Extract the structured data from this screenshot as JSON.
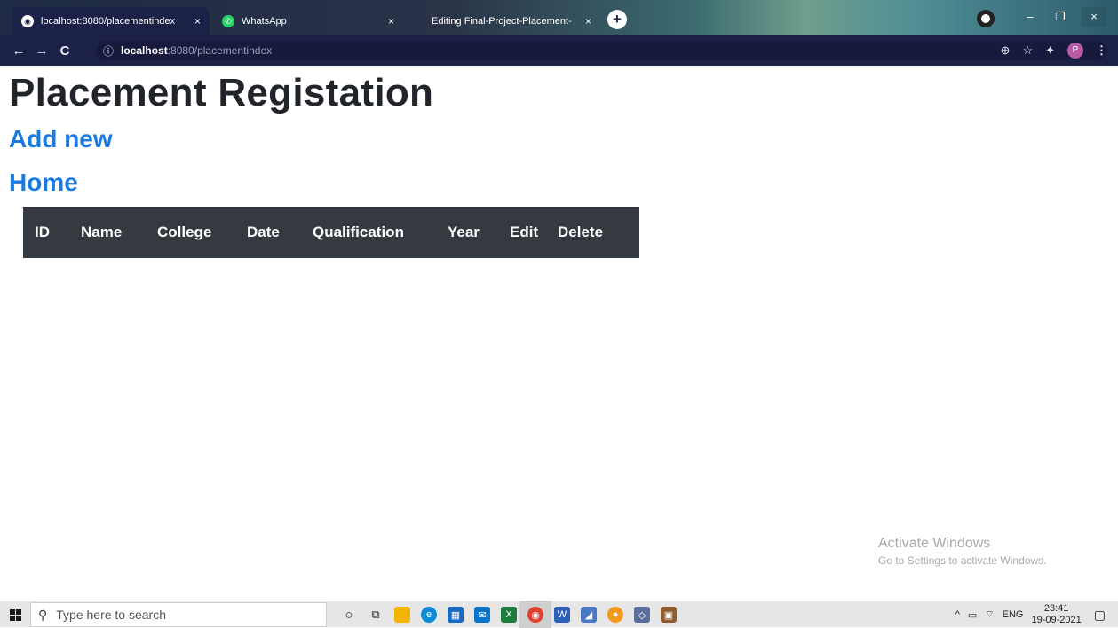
{
  "browser": {
    "tabs": [
      {
        "title": "localhost:8080/placementindex",
        "close": "×",
        "icon": "globe-icon",
        "active": true
      },
      {
        "title": "WhatsApp",
        "close": "×",
        "icon": "whatsapp-icon",
        "active": false
      },
      {
        "title": "Editing Final-Project-Placement-",
        "close": "×",
        "icon": "",
        "active": false
      }
    ],
    "new_tab": "+",
    "window": {
      "minimize": "–",
      "restore": "❐",
      "close": "×"
    },
    "nav": {
      "back": "←",
      "forward": "→",
      "reload": "C"
    },
    "url": {
      "info": "ⓘ",
      "host": "localhost",
      "rest": ":8080/placementindex"
    },
    "toolbar_right": {
      "zoom": "⊕",
      "star": "☆",
      "extensions": "✦",
      "profile": "P",
      "menu": "⋮"
    }
  },
  "page": {
    "title": "Placement Registation",
    "links": {
      "add_new": "Add new",
      "home": "Home"
    },
    "table": {
      "headers": [
        "ID",
        "Name",
        "College",
        "Date",
        "Qualification",
        "Year",
        "Edit",
        "Delete"
      ]
    }
  },
  "watermark": {
    "line1": "Activate Windows",
    "line2": "Go to Settings to activate Windows."
  },
  "taskbar": {
    "search_placeholder": "Type here to search",
    "tray": {
      "chevron": "^",
      "language": "ENG",
      "time": "23:41",
      "date": "19-09-2021"
    }
  },
  "colors": {
    "link": "#1b7ae3",
    "table_header_bg": "#343a40",
    "browser_bg": "#1c2247"
  }
}
